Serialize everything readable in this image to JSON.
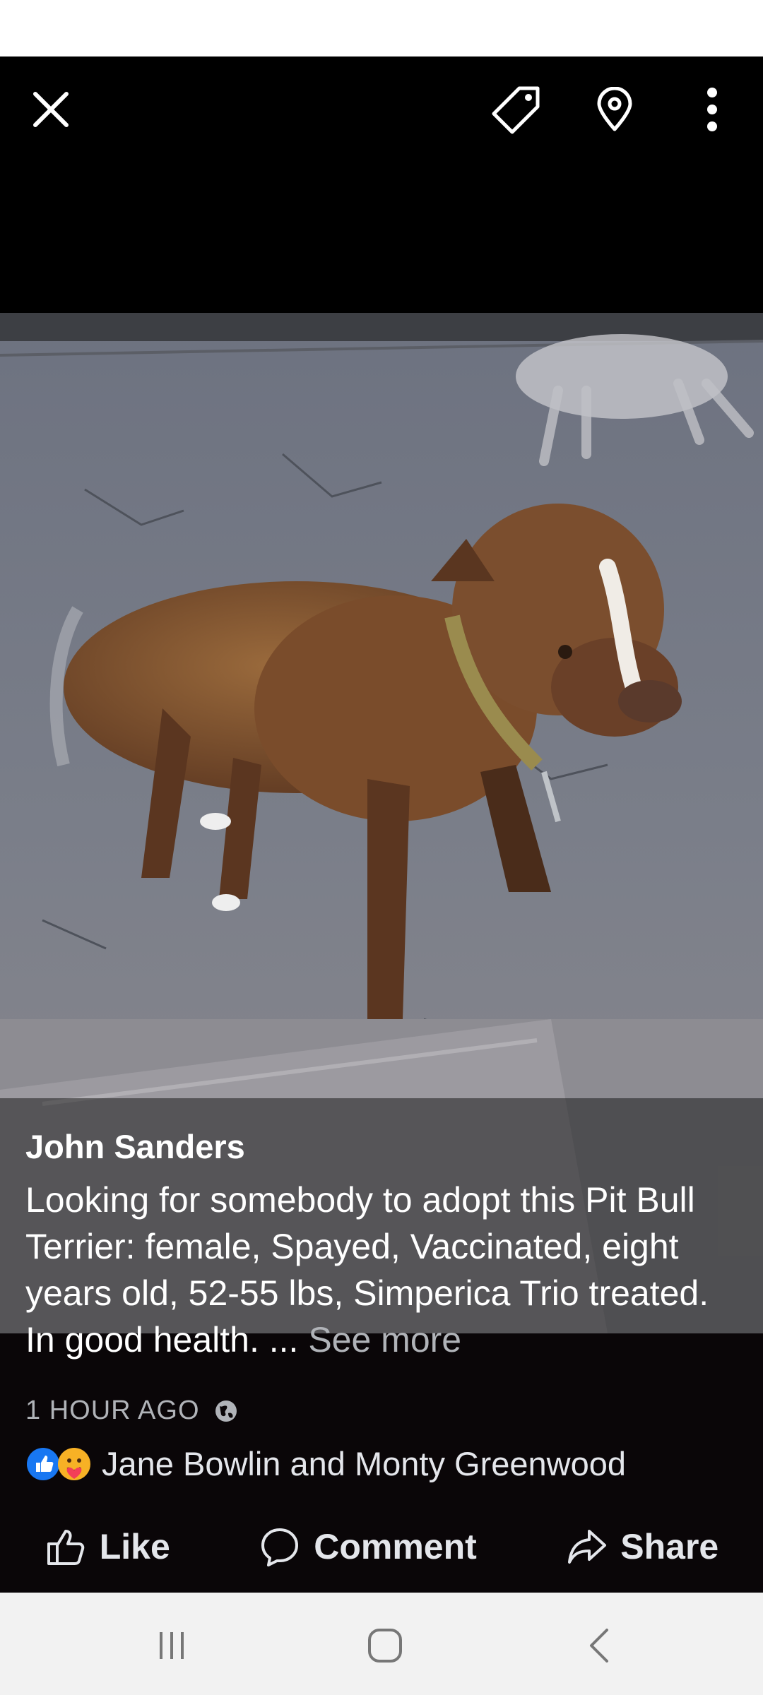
{
  "post": {
    "author": "John Sanders",
    "text": "Looking for somebody to adopt this Pit Bull Terrier: female, Spayed, Vaccinated, eight years old, 52-55 lbs, Simperica Trio treated. In good health. ...",
    "see_more": "See more",
    "time": "1 HOUR AGO",
    "reactors": "Jane Bowlin and Monty Greenwood"
  },
  "actions": {
    "like": "Like",
    "comment": "Comment",
    "share": "Share"
  },
  "icons": {
    "close": "close-icon",
    "tag": "tag-icon",
    "location": "location-pin-icon",
    "more": "more-vertical-icon",
    "globe": "globe-icon",
    "like_reaction": "like-reaction-icon",
    "care_reaction": "care-reaction-icon"
  },
  "colors": {
    "like_blue": "#1877f2",
    "care_yellow": "#f7b125",
    "secondary_text": "#b0b3b8"
  }
}
